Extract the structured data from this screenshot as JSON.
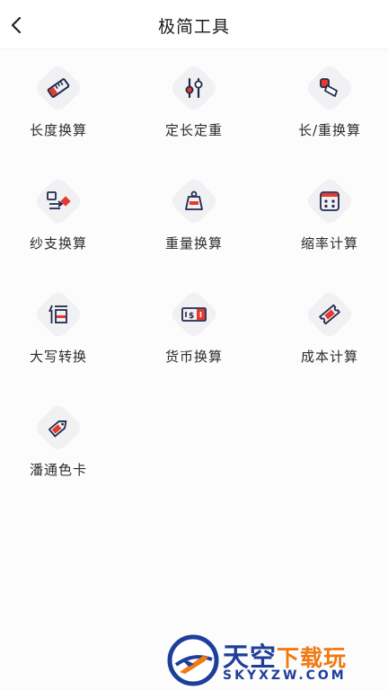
{
  "header": {
    "back_icon": "chevron-left-icon",
    "title": "极简工具"
  },
  "tools": [
    {
      "label": "长度换算",
      "icon": "ruler-icon"
    },
    {
      "label": "定长定重",
      "icon": "sliders-icon"
    },
    {
      "label": "长/重换算",
      "icon": "tag-convert-icon"
    },
    {
      "label": "纱支换算",
      "icon": "yarn-exchange-icon"
    },
    {
      "label": "重量换算",
      "icon": "weight-icon"
    },
    {
      "label": "缩率计算",
      "icon": "calculator-icon"
    },
    {
      "label": "大写转换",
      "icon": "uppercase-bai-icon"
    },
    {
      "label": "货币换算",
      "icon": "banknote-icon"
    },
    {
      "label": "成本计算",
      "icon": "ticket-icon"
    },
    {
      "label": "潘通色卡",
      "icon": "color-tag-icon"
    }
  ],
  "watermark": {
    "brand_main": "天空",
    "brand_sub": "下载玩",
    "url": "SKYXZW.COM"
  },
  "colors": {
    "icon_primary": "#1f2a4d",
    "icon_accent": "#e53a2e",
    "icon_bg": "#f1f1f4",
    "watermark_blue": "#1d3f9a",
    "watermark_orange": "#f07a13"
  }
}
